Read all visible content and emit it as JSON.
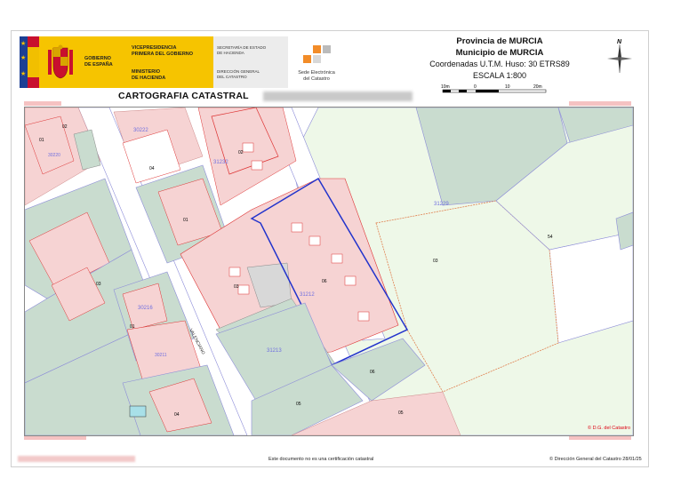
{
  "header": {
    "gobierno": "GOBIERNO\nDE ESPAÑA",
    "vicepresidencia": "VICEPRESIDENCIA\nPRIMERA DEL GOBIERNO",
    "ministerio": "MINISTERIO\nDE HACIENDA",
    "secretaria": "SECRETARÍA DE ESTADO\nDE HACIENDA",
    "direccion": "DIRECCIÓN GENERAL\nDEL CATASTRO",
    "sede": "Sede Electrónica\ndel Catastro",
    "title": "CARTOGRAFIA CATASTRAL"
  },
  "info": {
    "provincia": "Provincia de MURCIA",
    "municipio": "Municipio de MURCIA",
    "coordenadas": "Coordenadas U.T.M. Huso: 30 ETRS89",
    "escala": "ESCALA 1:800",
    "scale_ticks": [
      "10m",
      "0",
      "10",
      "20m"
    ],
    "north": "N"
  },
  "map": {
    "block_labels": [
      "31229",
      "31232",
      "30222",
      "30220",
      "31212",
      "31213",
      "30216",
      "30211"
    ],
    "parcel_numbers": [
      "01",
      "02",
      "03",
      "04",
      "05",
      "06",
      "54",
      "03",
      "06",
      "05",
      "04",
      "01",
      "02",
      "01",
      "03"
    ],
    "street_label": "VALENCIANO",
    "copyright_map": "© D.G. del Catastro"
  },
  "footer": {
    "note": "Este documento no es una certificación catastral",
    "copyright": "© Dirección General del Catastro 28/01/25"
  },
  "colors": {
    "built": "#f6d3d3",
    "garden": "#c9dccf",
    "green_parcel": "#e9f5e1",
    "line_red": "#d22",
    "line_blue": "#6060e0",
    "highlight": "#2233cc",
    "accent_yellow": "#f6c400"
  }
}
